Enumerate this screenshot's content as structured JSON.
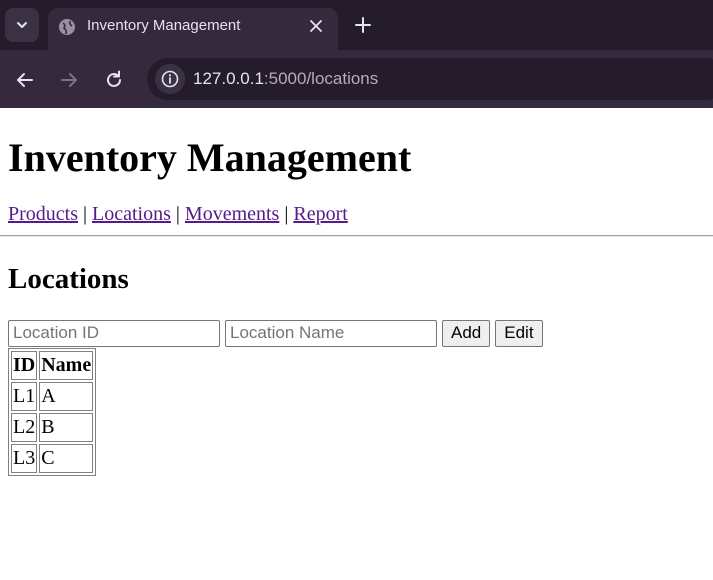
{
  "browser": {
    "tab": {
      "title": "Inventory Management",
      "favicon": "globe-icon"
    },
    "address_bar": {
      "url_host": "127.0.0.1",
      "url_rest": ":5000/locations"
    },
    "colors": {
      "tabstrip": "#241c2b",
      "toolbar": "#35293d",
      "text": "#e8e1ee"
    }
  },
  "page": {
    "title": "Inventory Management",
    "nav": [
      {
        "label": "Products"
      },
      {
        "label": "Locations"
      },
      {
        "label": "Movements"
      },
      {
        "label": "Report"
      }
    ],
    "nav_separator": "|",
    "section_title": "Locations",
    "form": {
      "location_id_placeholder": "Location ID",
      "location_name_placeholder": "Location Name",
      "add_label": "Add",
      "edit_label": "Edit"
    },
    "table": {
      "headers": [
        "ID",
        "Name"
      ],
      "rows": [
        [
          "L1",
          "A"
        ],
        [
          "L2",
          "B"
        ],
        [
          "L3",
          "C"
        ]
      ]
    },
    "colors": {
      "link_visited": "#551a8b"
    }
  }
}
